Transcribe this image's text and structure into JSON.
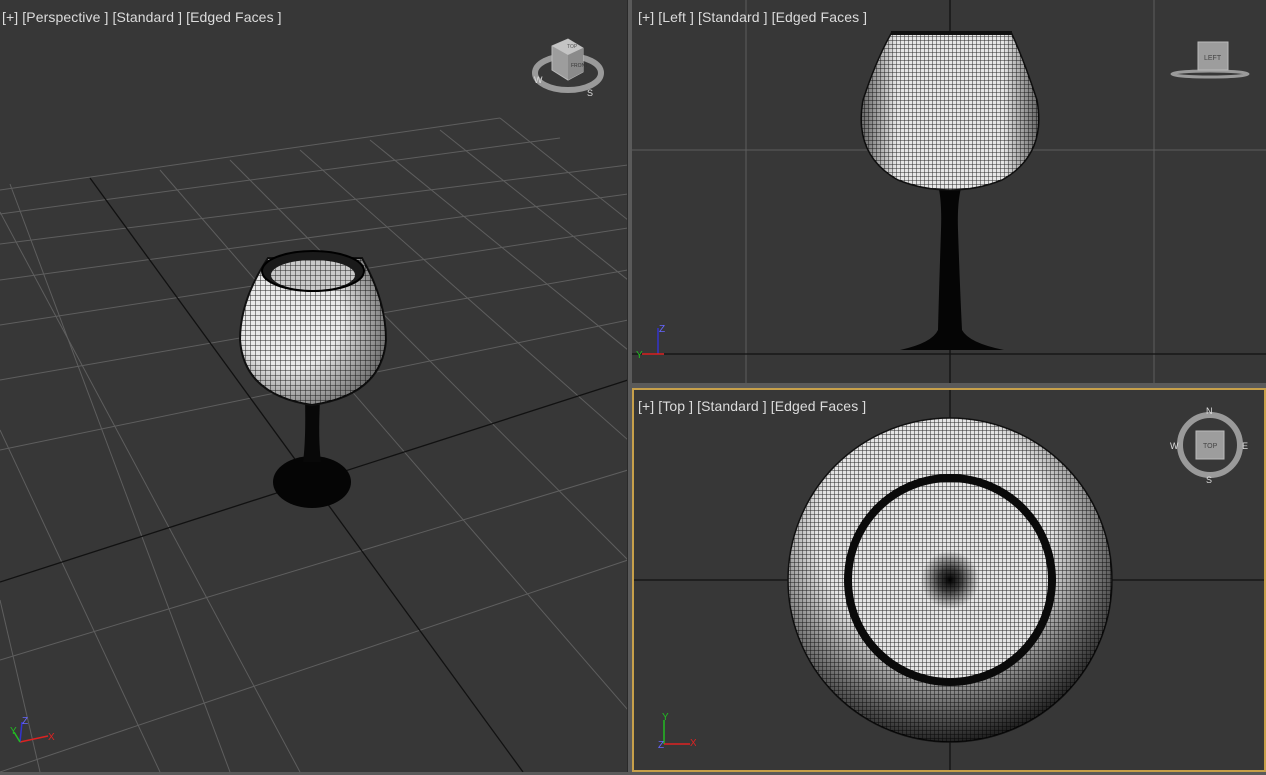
{
  "viewports": {
    "perspective": {
      "menu": "[+]",
      "view": "[Perspective ]",
      "shading": "[Standard ]",
      "edges": "[Edged Faces ]",
      "cube_top": "TOP",
      "cube_front": "FRONT",
      "compass": {
        "w": "W",
        "s": "S"
      }
    },
    "left": {
      "menu": "[+]",
      "view": "[Left ]",
      "shading": "[Standard ]",
      "edges": "[Edged Faces ]",
      "cube_face": "LEFT"
    },
    "top": {
      "menu": "[+]",
      "view": "[Top ]",
      "shading": "[Standard ]",
      "edges": "[Edged Faces ]",
      "cube_face": "TOP",
      "compass": {
        "n": "N",
        "s": "S",
        "e": "E",
        "w": "W"
      }
    }
  },
  "axes": {
    "x": "X",
    "y": "Y",
    "z": "Z"
  },
  "colors": {
    "viewport_bg": "#373737",
    "grid": "#5c5c5c",
    "active_border": "#c7a04a",
    "label": "#dcdcdc"
  }
}
